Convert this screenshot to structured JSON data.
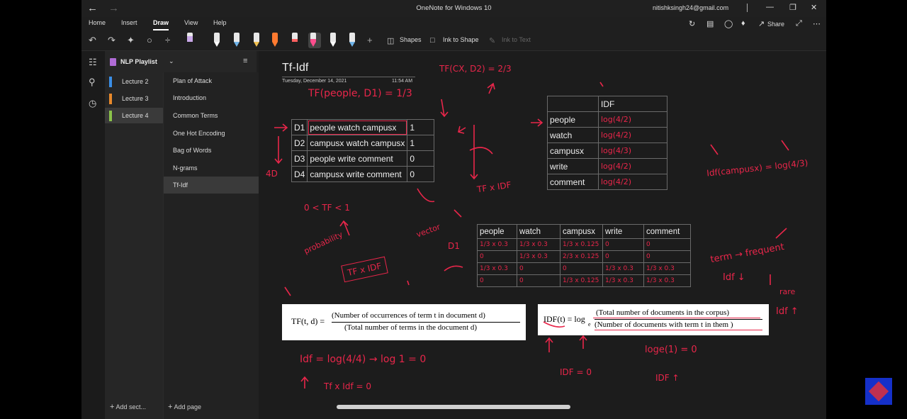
{
  "app": {
    "title": "OneNote for Windows 10",
    "user": "nitishksingh24@gmail.com"
  },
  "ribbon": {
    "tabs": [
      "Home",
      "Insert",
      "Draw",
      "View",
      "Help"
    ],
    "active_tab": "Draw",
    "share_label": "Share"
  },
  "toolbar": {
    "shapes_label": "Shapes",
    "ink_to_shape_label": "Ink to Shape",
    "ink_to_text_label": "Ink to Text",
    "pen_colors": [
      "#c9a8e8",
      "#ffffff",
      "#6fb3e8",
      "#f0c050",
      "#ff7a30",
      "#ff6060",
      "#ff4d8d",
      "#ffffff",
      "#6fb3e8"
    ]
  },
  "notebook": {
    "name": "NLP Playlist",
    "sections": [
      {
        "label": "Lecture 2",
        "color": "#3a8ee6"
      },
      {
        "label": "Lecture 3",
        "color": "#e8892b"
      },
      {
        "label": "Lecture 4",
        "color": "#8bc34a"
      }
    ],
    "pages": [
      "Plan of Attack",
      "Introduction",
      "Common Terms",
      "One Hot Encoding",
      "Bag of Words",
      "N-grams",
      "Tf-Idf"
    ],
    "add_section": "Add sect...",
    "add_page": "Add page"
  },
  "page": {
    "title": "Tf-Idf",
    "date": "Tuesday, December 14, 2021",
    "time": "11:54 AM"
  },
  "doc_table": [
    [
      "D1",
      "people watch campusx",
      "1"
    ],
    [
      "D2",
      "campusx watch campusx",
      "1"
    ],
    [
      "D3",
      "people write comment",
      "0"
    ],
    [
      "D4",
      "campusx write comment",
      "0"
    ]
  ],
  "idf_table": {
    "header": "IDF",
    "rows": [
      {
        "term": "people",
        "idf": "log(4/2)"
      },
      {
        "term": "watch",
        "idf": "log(4/2)"
      },
      {
        "term": "campusx",
        "idf": "log(4/3)"
      },
      {
        "term": "write",
        "idf": "log(4/2)"
      },
      {
        "term": "comment",
        "idf": "log(4/2)"
      }
    ]
  },
  "vector_table": {
    "headers": [
      "people",
      "watch",
      "campusx",
      "write",
      "comment"
    ],
    "rows": [
      [
        "1/3 x 0.3",
        "1/3 x 0.3",
        "1/3 x 0.125",
        "0",
        "0"
      ],
      [
        "0",
        "1/3 x 0.3",
        "2/3 x 0.125",
        "0",
        "0"
      ],
      [
        "1/3 x 0.3",
        "0",
        "0",
        "1/3 x 0.3",
        "1/3 x 0.3"
      ],
      [
        "0",
        "0",
        "1/3 x 0.125",
        "1/3 x 0.3",
        "1/3 x 0.3"
      ]
    ]
  },
  "formulas": {
    "tf": {
      "lhs": "TF(t, d) =",
      "numerator": "(Number of occurrences of term t in document d)",
      "denominator": "(Total number of terms in the document d)"
    },
    "idf": {
      "lhs": "IDF(t) = log",
      "base": "e",
      "numerator": "(Total number of documents in the corpus)",
      "denominator": "(Number of documents with term t in them )"
    }
  },
  "ink": {
    "tf_cx_d2": "TF(CX, D2) = 2/3",
    "tf_people_d1": "TF(people, D1) = 1/3",
    "d1_label": "D1",
    "tf_range": "0 < TF < 1",
    "probability": "probability",
    "vector": "vector",
    "tf_x_idf_box": "TF x IDF",
    "tf_x_idf": "TF x IDF",
    "four_d": "4D",
    "idf_campusx": "Idf(campusx) = log(4/3)",
    "term_frequent": "term → frequent",
    "idf_down": "Idf ↓",
    "rare": "rare",
    "idf_up": "Idf ↑",
    "idf_log": "Idf = log(4/4) → log 1 = 0",
    "tfxidf0": "Tf x Idf = 0",
    "log1": "loge(1) = 0",
    "idf_eq0": "IDF = 0",
    "idf_arrow": "IDF ↑"
  }
}
